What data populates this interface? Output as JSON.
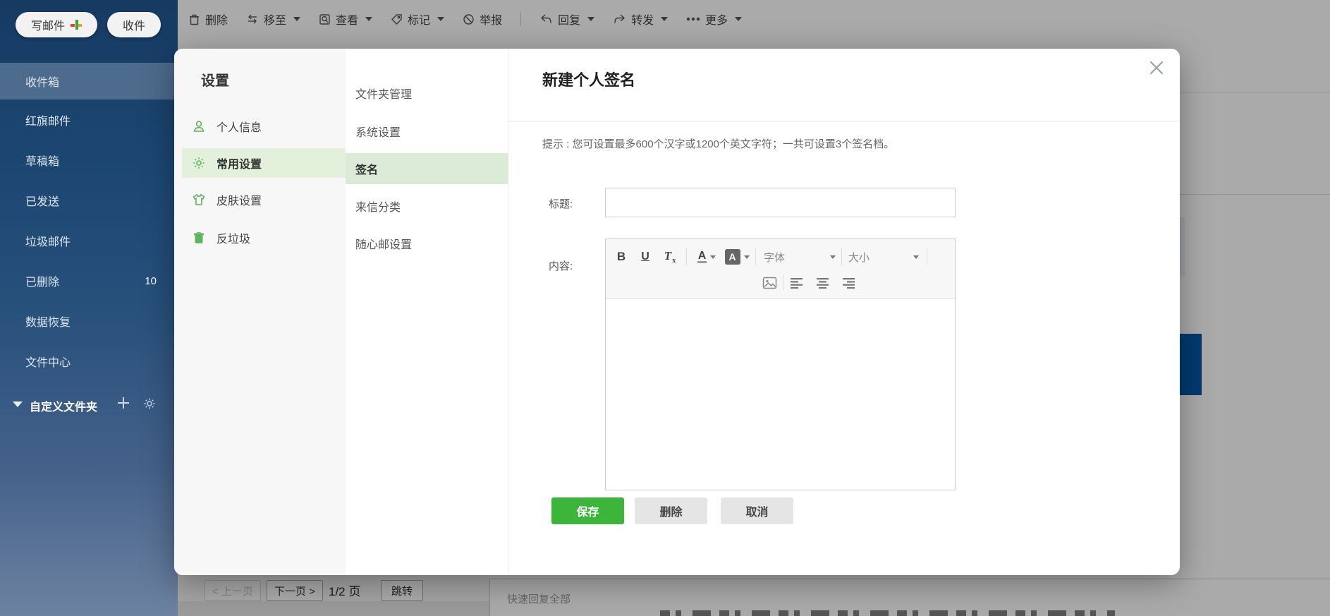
{
  "toolbar": {
    "items": [
      {
        "label": "删除",
        "icon": "trash-icon",
        "caret": false
      },
      {
        "label": "移至",
        "icon": "move-icon",
        "caret": true
      },
      {
        "label": "查看",
        "icon": "view-icon",
        "caret": true
      },
      {
        "label": "标记",
        "icon": "tag-icon",
        "caret": true
      },
      {
        "label": "举报",
        "icon": "report-icon",
        "caret": false
      },
      {
        "label": "回复",
        "icon": "reply-icon",
        "caret": true
      },
      {
        "label": "转发",
        "icon": "forward-icon",
        "caret": true
      },
      {
        "label": "更多",
        "icon": "more-dots-icon",
        "caret": true
      }
    ]
  },
  "sidebar": {
    "compose_label": "写邮件",
    "receive_label": "收件",
    "items": [
      {
        "label": "收件箱",
        "selected": true
      },
      {
        "label": "红旗邮件"
      },
      {
        "label": "草稿箱"
      },
      {
        "label": "已发送"
      },
      {
        "label": "垃圾邮件"
      },
      {
        "label": "已删除",
        "count": "10"
      },
      {
        "label": "数据恢复"
      },
      {
        "label": "文件中心"
      }
    ],
    "custom_folder_label": "自定义文件夹"
  },
  "modal": {
    "settings_title": "设置",
    "nav": [
      {
        "label": "个人信息",
        "icon": "person-icon"
      },
      {
        "label": "常用设置",
        "icon": "gear-icon",
        "selected": true
      },
      {
        "label": "皮肤设置",
        "icon": "shirt-icon"
      },
      {
        "label": "反垃圾",
        "icon": "trash-icon"
      }
    ],
    "subnav": [
      {
        "label": "文件夹管理"
      },
      {
        "label": "系统设置"
      },
      {
        "label": "签名",
        "selected": true
      },
      {
        "label": "来信分类"
      },
      {
        "label": "随心邮设置"
      }
    ],
    "panel": {
      "title": "新建个人签名",
      "tip": "提示 : 您可设置最多600个汉字或1200个英文字符；一共可设置3个签名档。",
      "title_label": "标题:",
      "content_label": "内容:",
      "editor": {
        "bold_label": "B",
        "underline_label": "U",
        "clear_format_label": "T",
        "text_color_label": "A",
        "bg_color_label": "A",
        "font_label": "字体",
        "size_label": "大小"
      },
      "save_label": "保存",
      "delete_label": "删除",
      "cancel_label": "取消"
    }
  },
  "pagination": {
    "prev": "< 上一页",
    "next": "下一页 >",
    "page_info": "1/2 页",
    "jump": "跳转"
  },
  "quick_reply_label": "快速回复全部",
  "colors": {
    "accent_green": "#3db53a",
    "nav_selected_bg": "#e3f0db",
    "subnav_selected_bg": "#dcebd7",
    "sidebar_selected_bg": "#4d6b8c",
    "underlay_blue": "#0057a8"
  }
}
